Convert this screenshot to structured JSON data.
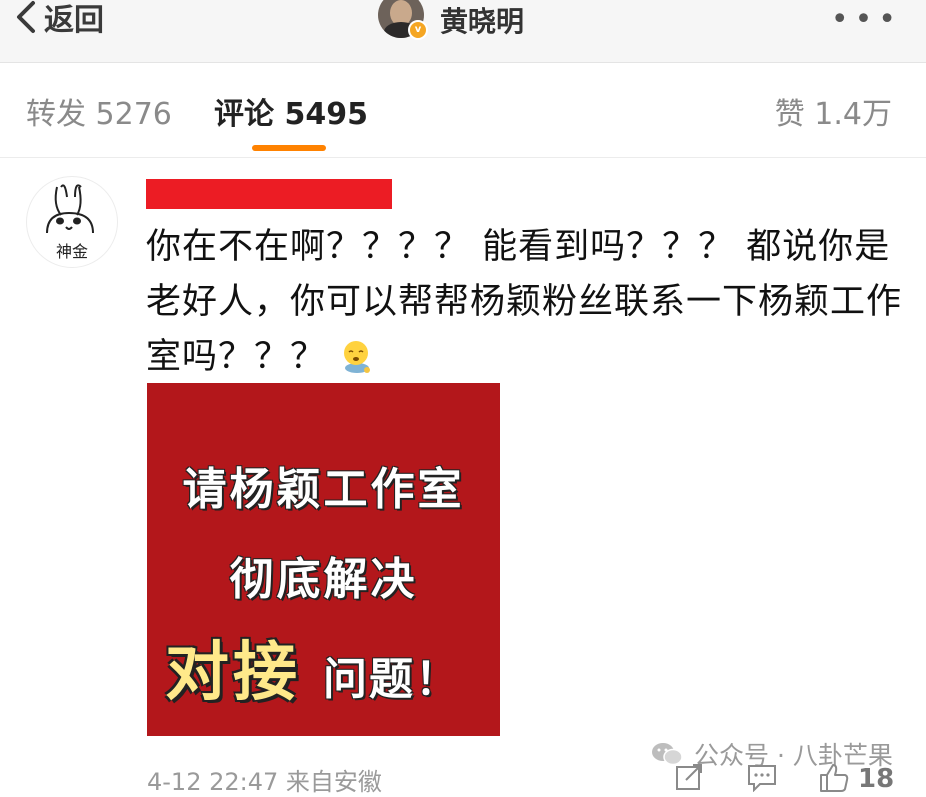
{
  "nav": {
    "back_label": "返回",
    "profile_name": "黄晓明",
    "more_label": "•••"
  },
  "tabs": {
    "repost": "转发 5276",
    "comment": "评论 5495",
    "like": "赞 1.4万",
    "active": "comment",
    "accent_color": "#ff8200"
  },
  "comment": {
    "avatar_text": "神金",
    "username_redacted_color": "#ec1c24",
    "text": "你在不在啊？？？？ 能看到吗？？？ 都说你是老好人，你可以帮帮杨颖粉丝联系一下杨颖工作室吗？？？",
    "emoji": "sleepy-face-emoji",
    "image": {
      "background": "#b3171b",
      "line1": "请杨颖工作室",
      "line2": "彻底解决",
      "line3_big": "对接",
      "line3_small": "问题！"
    },
    "meta": "4-12 22:47  来自安徽",
    "like_count": "18"
  },
  "watermark": "公众号 · 八卦芒果",
  "icons": [
    "chevron-left-icon",
    "more-icon",
    "share-icon",
    "comment-icon",
    "thumbs-up-icon",
    "wechat-icon"
  ]
}
